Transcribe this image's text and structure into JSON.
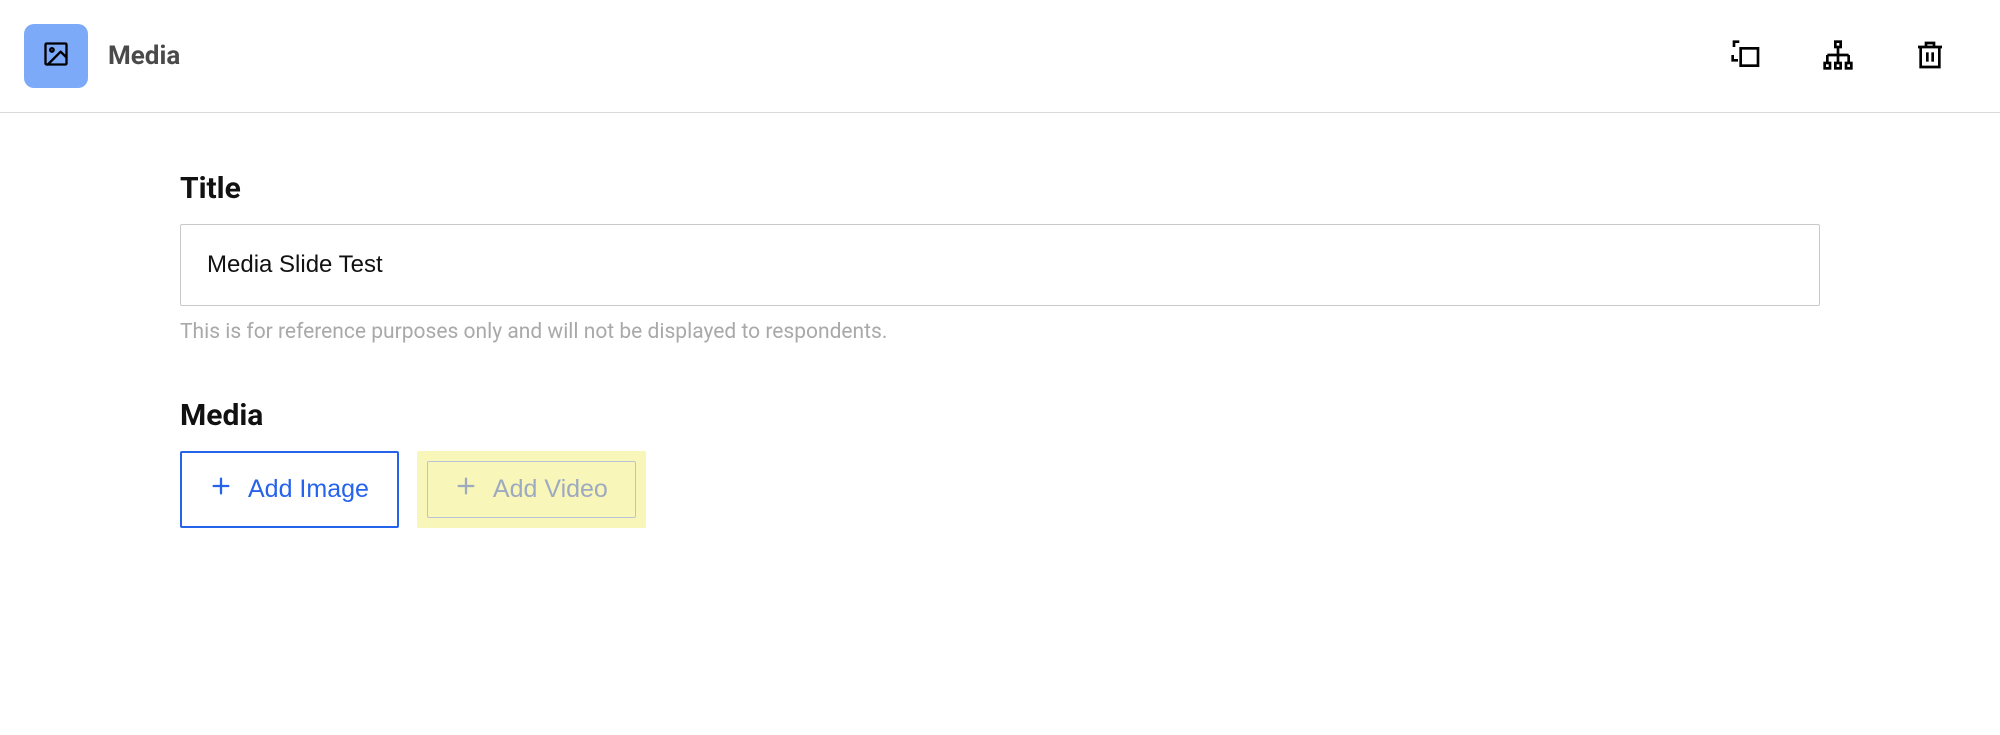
{
  "header": {
    "title": "Media"
  },
  "form": {
    "title_label": "Title",
    "title_value": "Media Slide Test",
    "title_helper": "This is for reference purposes only and will not be displayed to respondents.",
    "media_label": "Media",
    "add_image_label": "Add Image",
    "add_video_label": "Add Video"
  }
}
